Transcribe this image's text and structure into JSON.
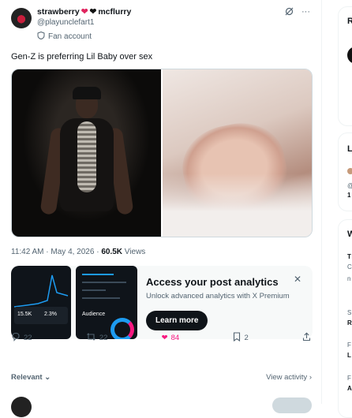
{
  "tweet": {
    "display_name": "strawberry",
    "display_name_2": "mcflurry",
    "handle": "@playunclefart1",
    "account_label": "Fan account",
    "text": "Gen-Z is preferring Lil Baby over sex",
    "time": "11:42 AM · May 4, 2026 ·",
    "views_count": "60.5K",
    "views_label": "Views"
  },
  "promo": {
    "title": "Access your post analytics",
    "subtitle": "Unlock advanced analytics with X Premium",
    "button": "Learn more",
    "phone_stat_1": "15.5K",
    "phone_stat_2": "2.3%",
    "phone_caption": "Audience"
  },
  "actions": {
    "replies": "22",
    "reposts": "22",
    "likes": "84",
    "bookmarks": "2"
  },
  "footer": {
    "relevant": "Relevant",
    "view_activity": "View activity"
  },
  "sidebar": {
    "c1": "R",
    "c2": "L",
    "c3": "@",
    "c4": "1",
    "c5": "W",
    "c6": "T",
    "c7": "C",
    "c8": "n",
    "c9": "S",
    "c10": "R",
    "c11": "F",
    "c12": "L",
    "c13": "F",
    "c14": "A"
  },
  "colors": {
    "accent": "#1d9bf0",
    "like": "#f91880",
    "text": "#0f1419",
    "muted": "#536471"
  }
}
